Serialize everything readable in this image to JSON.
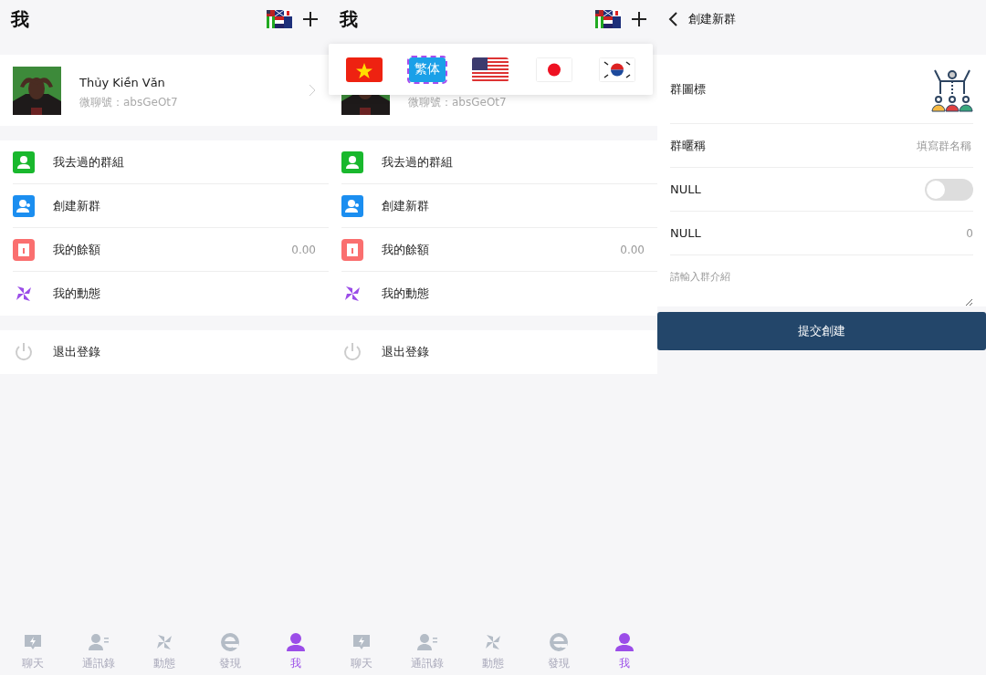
{
  "screens": [
    {
      "kind": "profile",
      "title": "我",
      "profile": {
        "name": "Thủy Kiền Văn",
        "wechat_id": "微聊號：absGeOt7"
      },
      "menu": [
        {
          "label": "我去過的群組"
        },
        {
          "label": "創建新群"
        },
        {
          "label": "我的餘額",
          "value": "0.00"
        },
        {
          "label": "我的動態"
        }
      ],
      "logout": "退出登錄",
      "tabs": [
        {
          "label": "聊天",
          "selected": false
        },
        {
          "label": "通訊錄",
          "selected": false
        },
        {
          "label": "動態",
          "selected": false
        },
        {
          "label": "發現",
          "selected": false
        },
        {
          "label": "我",
          "selected": true
        }
      ]
    },
    {
      "kind": "profile",
      "title": "我",
      "profile": {
        "wechat_id": "微聊號：absGeOt7"
      },
      "language_menu": [
        {
          "kind": "vietnam",
          "selected": false
        },
        {
          "kind": "text",
          "label": "繁体",
          "selected": true
        },
        {
          "kind": "usa",
          "selected": false
        },
        {
          "kind": "japan",
          "selected": false
        },
        {
          "kind": "korea",
          "selected": false
        }
      ],
      "menu": [
        {
          "label": "我去過的群組"
        },
        {
          "label": "創建新群"
        },
        {
          "label": "我的餘額",
          "value": "0.00"
        },
        {
          "label": "我的動態"
        }
      ],
      "logout": "退出登錄",
      "tabs": [
        {
          "label": "聊天",
          "selected": false
        },
        {
          "label": "通訊錄",
          "selected": false
        },
        {
          "label": "動態",
          "selected": false
        },
        {
          "label": "發現",
          "selected": false
        },
        {
          "label": "我",
          "selected": true
        }
      ]
    },
    {
      "kind": "create_group",
      "title": "創建新群",
      "rows": [
        {
          "kind": "icon",
          "label": "群圖標"
        },
        {
          "kind": "input",
          "label": "群暱稱",
          "placeholder": "填寫群名稱"
        },
        {
          "kind": "switch",
          "label": "NULL",
          "on": false
        },
        {
          "kind": "value",
          "label": "NULL",
          "value": "0"
        }
      ],
      "intro": {
        "placeholder": "請輸入群介紹"
      },
      "submit": "提交創建"
    }
  ]
}
